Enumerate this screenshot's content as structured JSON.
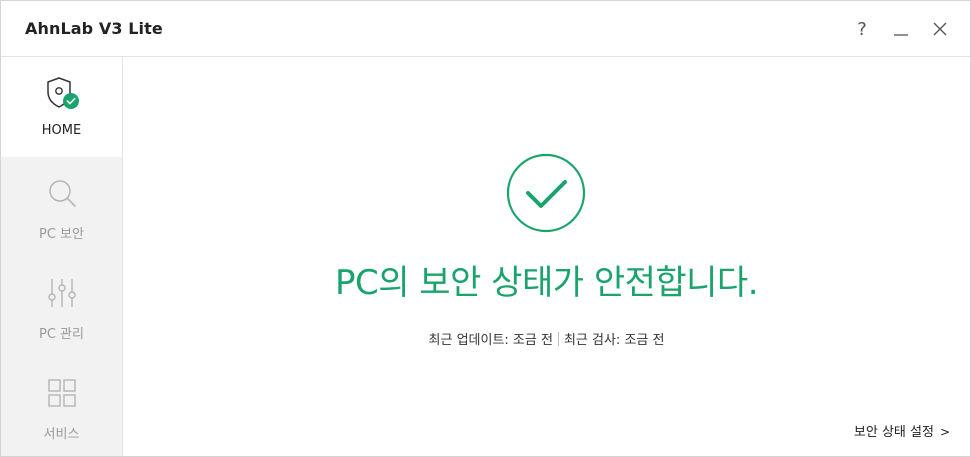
{
  "window": {
    "title": "AhnLab V3 Lite",
    "controls": {
      "help": "?",
      "minimize": "minimize",
      "close": "close"
    }
  },
  "sidebar": {
    "items": [
      {
        "label": "HOME",
        "icon": "shield-check-icon",
        "active": true
      },
      {
        "label": "PC 보안",
        "icon": "search-icon",
        "active": false
      },
      {
        "label": "PC 관리",
        "icon": "sliders-icon",
        "active": false
      },
      {
        "label": "서비스",
        "icon": "grid-icon",
        "active": false
      }
    ]
  },
  "main": {
    "status_icon": "check-circle-icon",
    "status_message": "PC의 보안 상태가 안전합니다.",
    "last_update": "최근 업데이트: 조금 전",
    "last_scan": "최근 검사: 조금 전",
    "settings_link": "보안 상태 설정",
    "settings_chevron": ">"
  },
  "colors": {
    "accent_green": "#1aa36b",
    "sidebar_bg": "#f2f2f2",
    "inactive_text": "#9a9a9a"
  }
}
